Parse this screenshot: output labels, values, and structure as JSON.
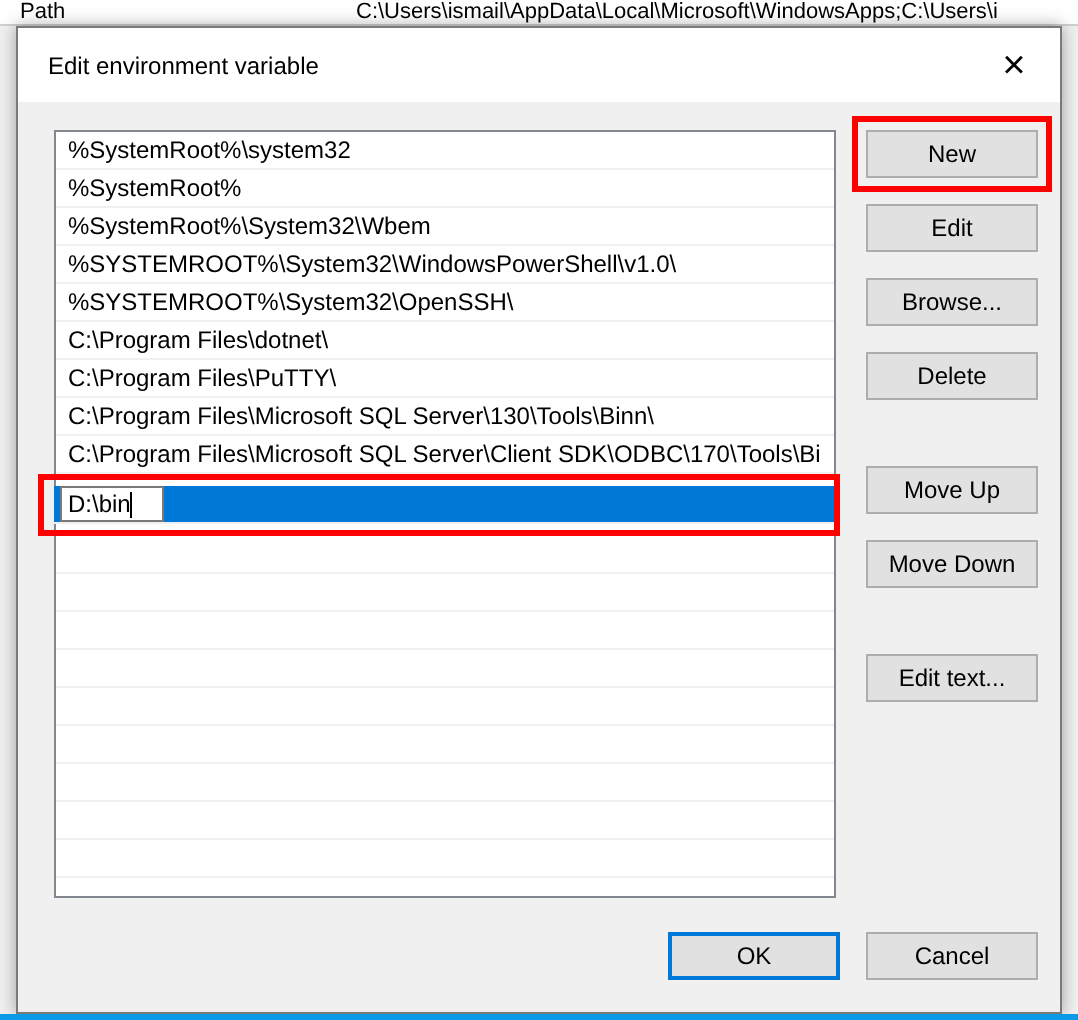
{
  "background_window": {
    "row": {
      "name": "Path",
      "value": "C:\\Users\\ismail\\AppData\\Local\\Microsoft\\WindowsApps;C:\\Users\\i"
    }
  },
  "dialog": {
    "title": "Edit environment variable",
    "close": "×",
    "list": [
      {
        "kind": "entry",
        "text": "%SystemRoot%\\system32",
        "selected": false,
        "highlighted": false
      },
      {
        "kind": "entry",
        "text": "%SystemRoot%",
        "selected": false,
        "highlighted": false
      },
      {
        "kind": "entry",
        "text": "%SystemRoot%\\System32\\Wbem",
        "selected": false,
        "highlighted": false
      },
      {
        "kind": "entry",
        "text": "%SYSTEMROOT%\\System32\\WindowsPowerShell\\v1.0\\",
        "selected": false,
        "highlighted": false
      },
      {
        "kind": "entry",
        "text": "%SYSTEMROOT%\\System32\\OpenSSH\\",
        "selected": false,
        "highlighted": false
      },
      {
        "kind": "entry",
        "text": "C:\\Program Files\\dotnet\\",
        "selected": false,
        "highlighted": false
      },
      {
        "kind": "entry",
        "text": "C:\\Program Files\\PuTTY\\",
        "selected": false,
        "highlighted": false
      },
      {
        "kind": "entry",
        "text": "C:\\Program Files\\Microsoft SQL Server\\130\\Tools\\Binn\\",
        "selected": false,
        "highlighted": false
      },
      {
        "kind": "entry",
        "text": "C:\\Program Files\\Microsoft SQL Server\\Client SDK\\ODBC\\170\\Tools\\Bi",
        "selected": false,
        "highlighted": false
      },
      {
        "kind": "editor",
        "text": "D:\\bin",
        "selected": true,
        "highlighted": true
      }
    ],
    "button_groups": [
      [
        {
          "label": "New",
          "highlighted": true
        },
        {
          "label": "Edit",
          "highlighted": false
        },
        {
          "label": "Browse...",
          "highlighted": false
        },
        {
          "label": "Delete",
          "highlighted": false
        }
      ],
      [
        {
          "label": "Move Up",
          "highlighted": false
        },
        {
          "label": "Move Down",
          "highlighted": false
        }
      ],
      [
        {
          "label": "Edit text...",
          "highlighted": false
        }
      ]
    ],
    "footer_buttons": [
      {
        "label": "OK",
        "default": true
      },
      {
        "label": "Cancel",
        "default": false
      }
    ]
  }
}
